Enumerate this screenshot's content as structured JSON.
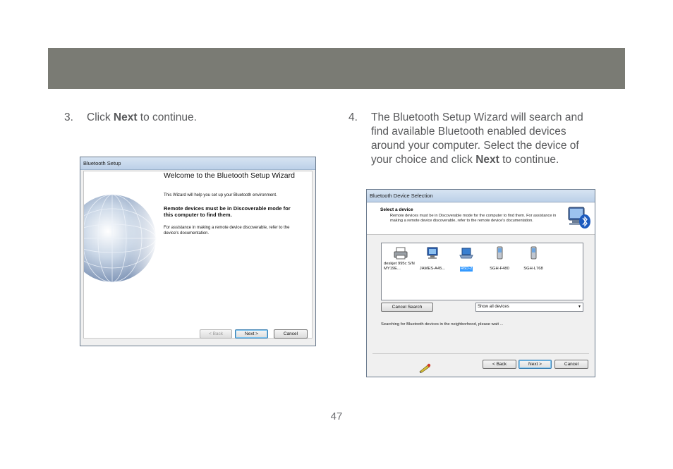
{
  "page_number": "47",
  "step3": {
    "number": "3.",
    "text_before": "Click ",
    "bold": "Next",
    "text_after": " to continue."
  },
  "step4": {
    "number": "4.",
    "text_before": "The Bluetooth Setup Wizard will search and find available Bluetooth enabled devices around your computer.  Select the device of your choice and click ",
    "bold": "Next",
    "text_after": " to continue."
  },
  "window1": {
    "title": "Bluetooth Setup",
    "heading": "Welcome to the Bluetooth Setup Wizard",
    "para1": "This Wizard will help you set up your Bluetooth environment.",
    "para2": "Remote devices must be in Discoverable mode for this computer to find them.",
    "para3": "For assistance in making a remote device discoverable, refer to the device's documentation.",
    "buttons": {
      "back": "< Back",
      "next": "Next >",
      "cancel": "Cancel"
    }
  },
  "window2": {
    "title": "Bluetooth Device Selection",
    "select_title": "Select a device",
    "select_desc": "Remote devices must be in Discoverable mode for the computer to find them. For assistance in making a remote device discoverable, refer to the remote device's documentation.",
    "devices": [
      {
        "label": "deskjet 995c S/N MY19E...",
        "icon": "printer-icon",
        "selected": false
      },
      {
        "label": "JAMES-A45...",
        "icon": "computer-icon",
        "selected": false
      },
      {
        "label": "R6D-2",
        "icon": "laptop-icon",
        "selected": true
      },
      {
        "label": "SGH-F480",
        "icon": "phone-icon",
        "selected": false
      },
      {
        "label": "SGH-L768",
        "icon": "phone-icon",
        "selected": false
      }
    ],
    "cancel_search": "Cancel Search",
    "filter": "Show all devices",
    "status": "Searching for Bluetooth devices in the neighborhood, please wait ...",
    "buttons": {
      "back": "< Back",
      "next": "Next >",
      "cancel": "Cancel"
    }
  }
}
